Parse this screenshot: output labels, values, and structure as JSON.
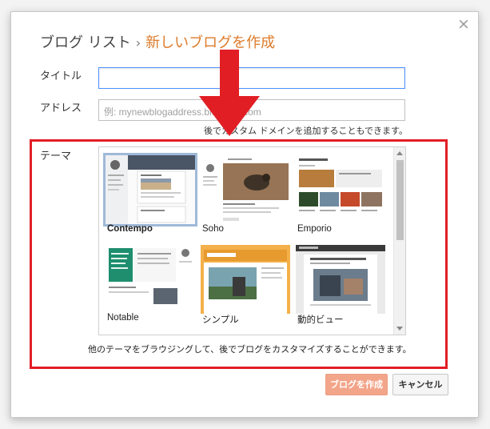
{
  "dialog": {
    "breadcrumb": {
      "parent": "ブログ リスト",
      "separator": "›",
      "current": "新しいブログを作成"
    },
    "close": "×"
  },
  "form": {
    "title_label": "タイトル",
    "title_value": "",
    "address_label": "アドレス",
    "address_placeholder": "例: mynewblogaddress.blogspot.com",
    "address_hint": "後でカスタム ドメインを追加することもできます。",
    "theme_label": "テーマ"
  },
  "themes": [
    {
      "name": "Contempo",
      "selected": true
    },
    {
      "name": "Soho",
      "selected": false
    },
    {
      "name": "Emporio",
      "selected": false
    },
    {
      "name": "Notable",
      "selected": false
    },
    {
      "name": "シンプル",
      "selected": false
    },
    {
      "name": "動的ビュー",
      "selected": false
    }
  ],
  "theme_footer": "他のテーマをブラウジングして、後でブログをカスタマイズすることができます。",
  "buttons": {
    "create": "ブログを作成",
    "cancel": "キャンセル"
  },
  "colors": {
    "accent": "#dd7b2a",
    "focus_border": "#4d90fe",
    "annotation_red": "#e21e25",
    "create_button": "#f3a58a"
  },
  "annotation": {
    "icon": "red-down-arrow-icon"
  }
}
